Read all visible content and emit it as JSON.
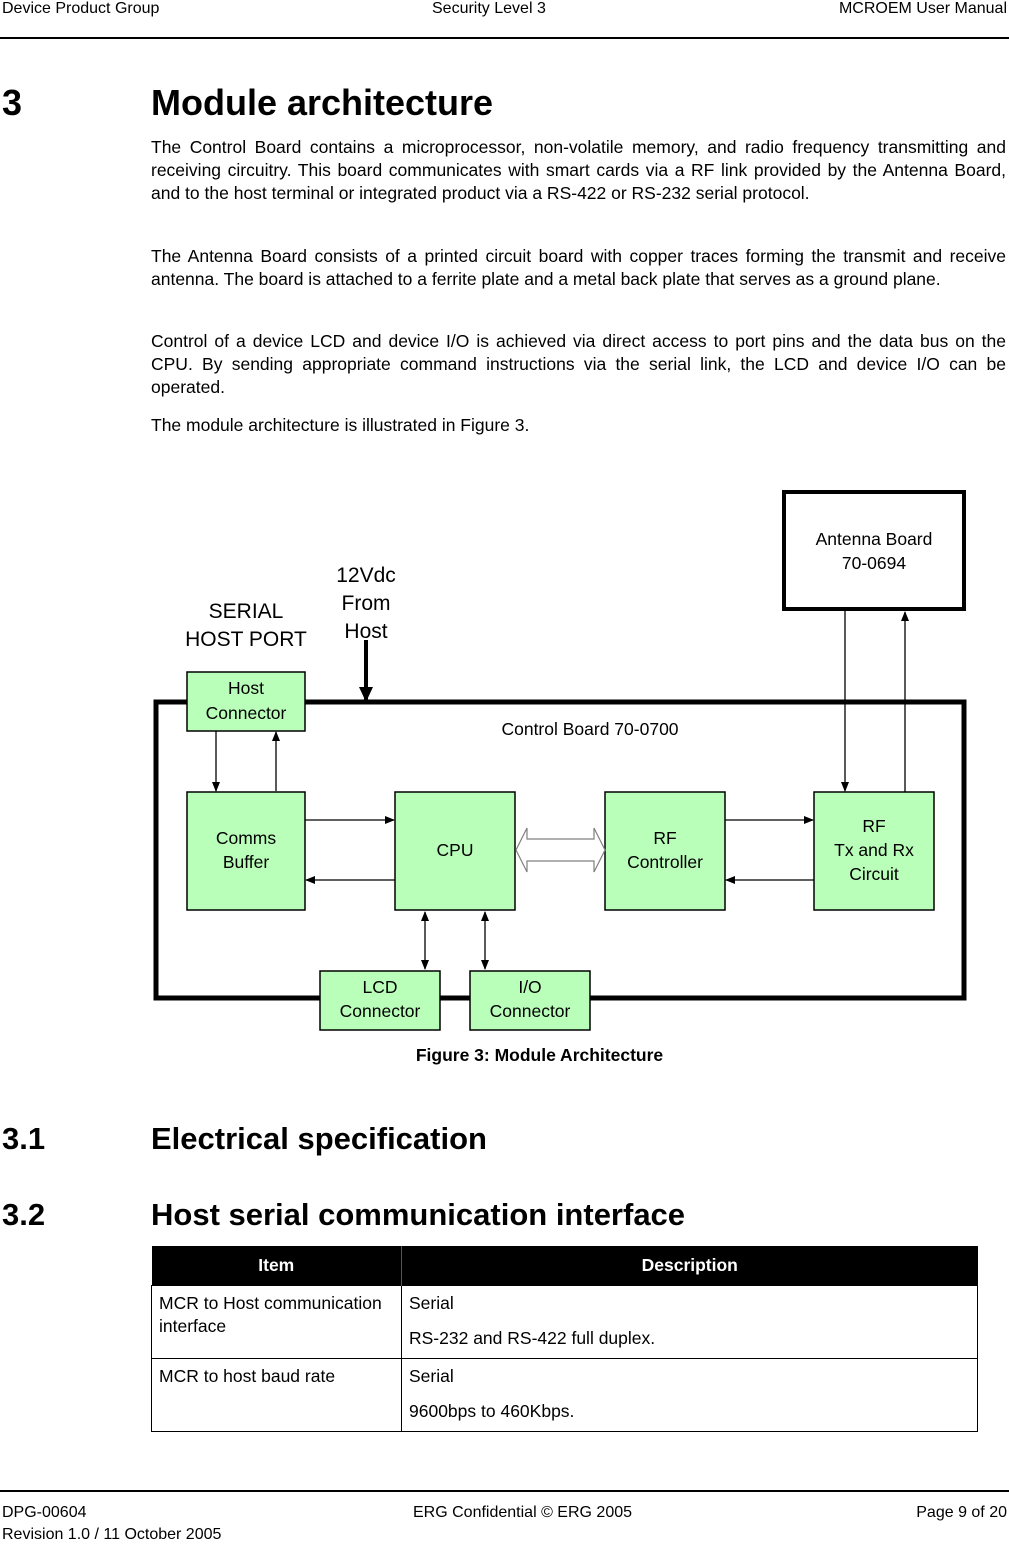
{
  "header": {
    "left": "Device Product Group",
    "center": "Security Level 3",
    "right": "MCROEM User Manual"
  },
  "section3": {
    "number": "3",
    "title": "Module architecture",
    "paragraphs": [
      "The Control Board contains a microprocessor, non-volatile memory, and radio frequency transmitting and receiving circuitry.  This board communicates with smart cards via a RF link provided by the Antenna Board, and to the host terminal or integrated product via a RS-422 or RS-232 serial protocol.",
      "The Antenna Board consists of a printed circuit board with copper traces forming the transmit and receive antenna.  The board is attached to a ferrite plate and a metal back plate that serves as a ground plane.",
      "Control of a device LCD and device I/O is achieved via direct access to port pins and the data bus on the CPU. By sending appropriate command instructions via the serial link, the LCD and device I/O can be operated.",
      "The module architecture is illustrated in Figure 3."
    ]
  },
  "figure": {
    "caption": "Figure 3: Module Architecture",
    "colors": {
      "block_fill": "#b9ffb9",
      "stroke": "#000000",
      "bus_arrow": "#808080"
    },
    "labels": {
      "serial_host_port": [
        "SERIAL",
        "HOST PORT"
      ],
      "power": [
        "12Vdc",
        "From",
        "Host"
      ],
      "control_board": "Control Board 70-0700",
      "antenna_board": [
        "Antenna Board",
        "70-0694"
      ],
      "host_connector": [
        "Host",
        "Connector"
      ],
      "comms_buffer": [
        "Comms",
        "Buffer"
      ],
      "cpu": [
        "CPU"
      ],
      "rf_controller": [
        "RF",
        "Controller"
      ],
      "rf_txrx": [
        "RF",
        "Tx and Rx",
        "Circuit"
      ],
      "lcd_connector": [
        "LCD",
        "Connector"
      ],
      "io_connector": [
        "I/O",
        "Connector"
      ]
    }
  },
  "section3_1": {
    "number": "3.1",
    "title": "Electrical specification"
  },
  "section3_2": {
    "number": "3.2",
    "title": "Host serial communication interface"
  },
  "spec_table": {
    "headers": [
      "Item",
      "Description"
    ],
    "rows": [
      {
        "item": "MCR to Host communication interface",
        "desc_line1": "Serial",
        "desc_line2": "RS-232 and RS-422 full duplex."
      },
      {
        "item": "MCR to host baud rate",
        "desc_line1": "Serial",
        "desc_line2": "9600bps to 460Kbps."
      }
    ]
  },
  "footer": {
    "doc_id": "DPG-00604",
    "revision": "Revision 1.0 / 11 October 2005",
    "confidential": "ERG Confidential © ERG 2005",
    "page": "Page 9 of 20"
  }
}
